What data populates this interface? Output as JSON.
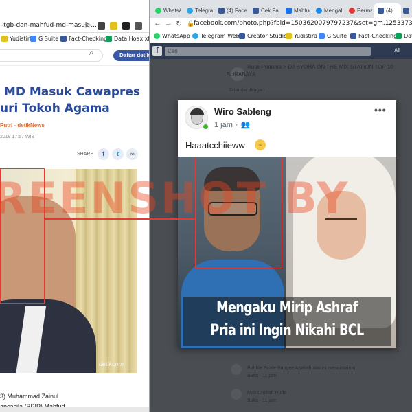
{
  "left_window": {
    "url": "-tgb-dan-mahfud-md-masuk-...",
    "bookmarks": [
      "Yudistira",
      "G Suite",
      "Fact-Checking",
      "Data Hoax.xlsx -"
    ],
    "daftar_label": "Daftar detik",
    "article": {
      "title": " MD Masuk Cawapres\nuri Tokoh Agama",
      "author": "Putri - detikNews",
      "date": "2018 17:57 WIB",
      "share_label": "SHARE",
      "bottom_text": "3) Muhammad Zainul\nancasila (BPIP) Mahfud"
    },
    "photo_watermark": "detikcom"
  },
  "right_window": {
    "tabs": [
      "WhatsA",
      "Telegra",
      "(4) Face",
      "Cek Fa",
      "Mahfud",
      "Mengal",
      "Perma",
      "(4)"
    ],
    "url": "facebook.com/photo.php?fbid=1503620079797237&set=gm.1253373615021833&ty",
    "bookmarks": [
      "WhatsApp",
      "Telegram Web",
      "Creator Studio",
      "Yudistira",
      "G Suite",
      "Fact-Checking",
      "Data"
    ],
    "fb_search_placeholder": "Cari",
    "fb_user_short": "Ali",
    "dim_post_header": "Rusli Pratama > DJ BYOHA ON THE MIX STATION TOP 10\nSURABAYA",
    "dim_post_sub": "Ditandai dengan",
    "dim_comments": [
      "Bubble Pirate Bungee Apakah aku ini mencintaimu\nSuka · 11 jam",
      "Mas Cholish Huda\nSuka · 11 jam"
    ]
  },
  "post": {
    "author": "Wiro Sableng",
    "time": "1 jam",
    "audience_icon": "friends-icon",
    "text": "Haaatcchiieww",
    "emoji": "sneezing-face",
    "caption_line1": "Mengaku Mirip Ashraf",
    "caption_line2": "Pria ini Ingin Nikahi BCL"
  },
  "watermark_text": "REENSHOT BY",
  "colors": {
    "detik_blue": "#2a4b9b",
    "author_orange": "#e2682b",
    "fb_blue": "#3b5998",
    "highlight_red": "#e53935",
    "watermark": "#eb461e"
  }
}
